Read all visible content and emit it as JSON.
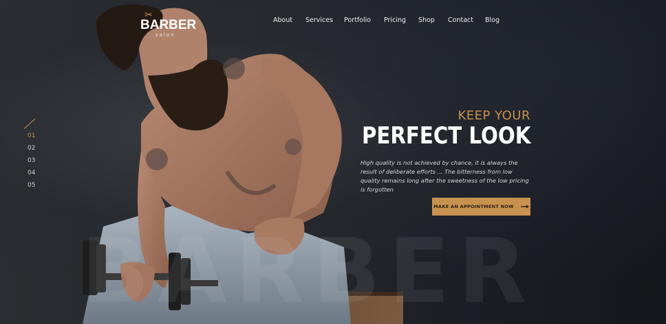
{
  "brand": {
    "logo_word": "BARBER",
    "logo_sub": "salon",
    "scissors_icon": "scissors-icon"
  },
  "nav": {
    "items": [
      {
        "label": "About"
      },
      {
        "label": "Services"
      },
      {
        "label": "Portfolio"
      },
      {
        "label": "Pricing"
      },
      {
        "label": "Shop"
      },
      {
        "label": "Contact"
      },
      {
        "label": "Blog"
      }
    ]
  },
  "slider": {
    "numbers": [
      "01",
      "02",
      "03",
      "04",
      "05"
    ],
    "active_index": 0
  },
  "hero": {
    "subtitle": "KEEP YOUR",
    "title": "PERFECT LOOK",
    "description": "High quality is not achieved by chance, it is always the result of deliberate efforts ... The bitterness from low quality remains long after the sweetness of the low pricing is forgotten",
    "cta_label": "MAKE AN APPOINTMENT NOW",
    "cta_icon": "arrow-right-icon",
    "watermark": "BARBER"
  },
  "colors": {
    "accent": "#c79150",
    "background": "#1b1e24",
    "text": "#ffffff"
  }
}
